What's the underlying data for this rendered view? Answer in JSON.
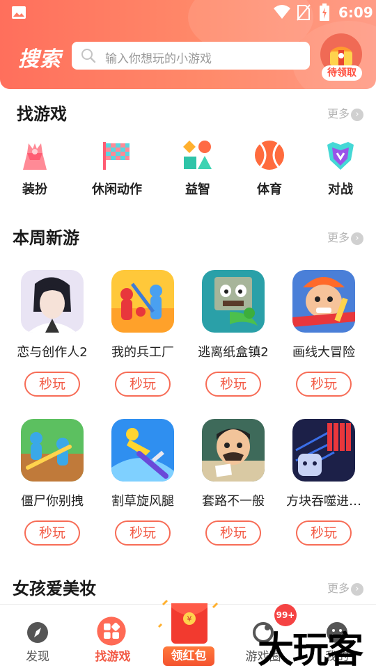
{
  "status_bar": {
    "time": "6:09"
  },
  "header": {
    "brand": "搜索",
    "search_placeholder": "输入你想玩的小游戏",
    "gift_badge": "待领取"
  },
  "find_games": {
    "title": "找游戏",
    "more": "更多",
    "categories": [
      {
        "label": "装扮",
        "icon": "dress-up-icon"
      },
      {
        "label": "休闲动作",
        "icon": "checkered-flag-icon"
      },
      {
        "label": "益智",
        "icon": "puzzle-shapes-icon"
      },
      {
        "label": "体育",
        "icon": "ball-icon"
      },
      {
        "label": "对战",
        "icon": "shield-battle-icon"
      }
    ]
  },
  "weekly_new": {
    "title": "本周新游",
    "more": "更多",
    "play_label": "秒玩",
    "games": [
      {
        "name": "恋与创作人2"
      },
      {
        "name": "我的兵工厂"
      },
      {
        "name": "逃离纸盒镇2"
      },
      {
        "name": "画线大冒险"
      },
      {
        "name": "僵尸你别拽"
      },
      {
        "name": "割草旋风腿"
      },
      {
        "name": "套路不一般"
      },
      {
        "name": "方块吞噬进…"
      }
    ]
  },
  "girls_makeup": {
    "title": "女孩爱美妆",
    "more": "更多"
  },
  "bottom_nav": {
    "tabs": [
      {
        "label": "发现"
      },
      {
        "label": "找游戏"
      },
      {
        "label": "领红包"
      },
      {
        "label": "游戏圈"
      },
      {
        "label": "我的"
      }
    ],
    "badge": "99+"
  },
  "watermark": "大玩客",
  "colors": {
    "accent": "#f25a45",
    "header_start": "#ff6f5c",
    "header_end": "#ff9c86"
  }
}
